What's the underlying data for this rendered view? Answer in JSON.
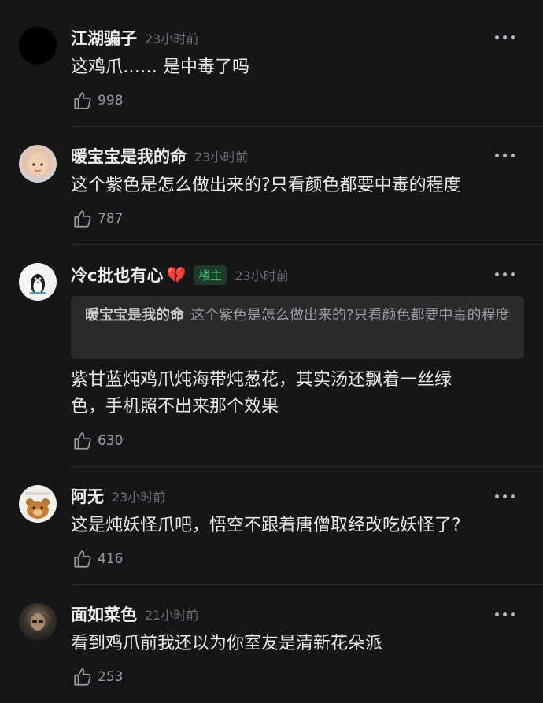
{
  "comments": [
    {
      "username": "江湖骗子",
      "time": "23小时前",
      "text": "这鸡爪…… 是中毒了吗",
      "likes": "998",
      "avatar_icon": "black-circle-avatar"
    },
    {
      "username": "暖宝宝是我的命",
      "time": "23小时前",
      "text": "这个紫色是怎么做出来的?只看颜色都要中毒的程度",
      "likes": "787",
      "avatar_icon": "baby-photo-avatar"
    },
    {
      "username": "冷c批也有心",
      "emoji": "💔",
      "badge": "楼主",
      "time": "23小时前",
      "quote_name": "暖宝宝是我的命",
      "quote_text": "这个紫色是怎么做出来的?只看颜色都要中毒的程度",
      "text_line1": "紫甘蓝炖鸡爪炖海带炖葱花，其实汤还飘着一丝绿",
      "text_line2": "色，手机照不出来那个效果",
      "likes": "630",
      "avatar_icon": "penguin-avatar"
    },
    {
      "username": "阿无",
      "time": "23小时前",
      "text": "这是炖妖怪爪吧，悟空不跟着唐僧取经改吃妖怪了?",
      "likes": "416",
      "avatar_icon": "bear-cartoon-avatar"
    },
    {
      "username": "面如菜色",
      "time": "21小时前",
      "text": "看到鸡爪前我还以为你室友是清新花朵派",
      "likes": "253",
      "avatar_icon": "man-photo-avatar"
    }
  ],
  "colors": {
    "background": "#161618",
    "badge_text": "#3fbf6f",
    "badge_bg": "#1f3a2a",
    "heart": "#e02b3a",
    "quote_bg": "#2a2a2d"
  }
}
